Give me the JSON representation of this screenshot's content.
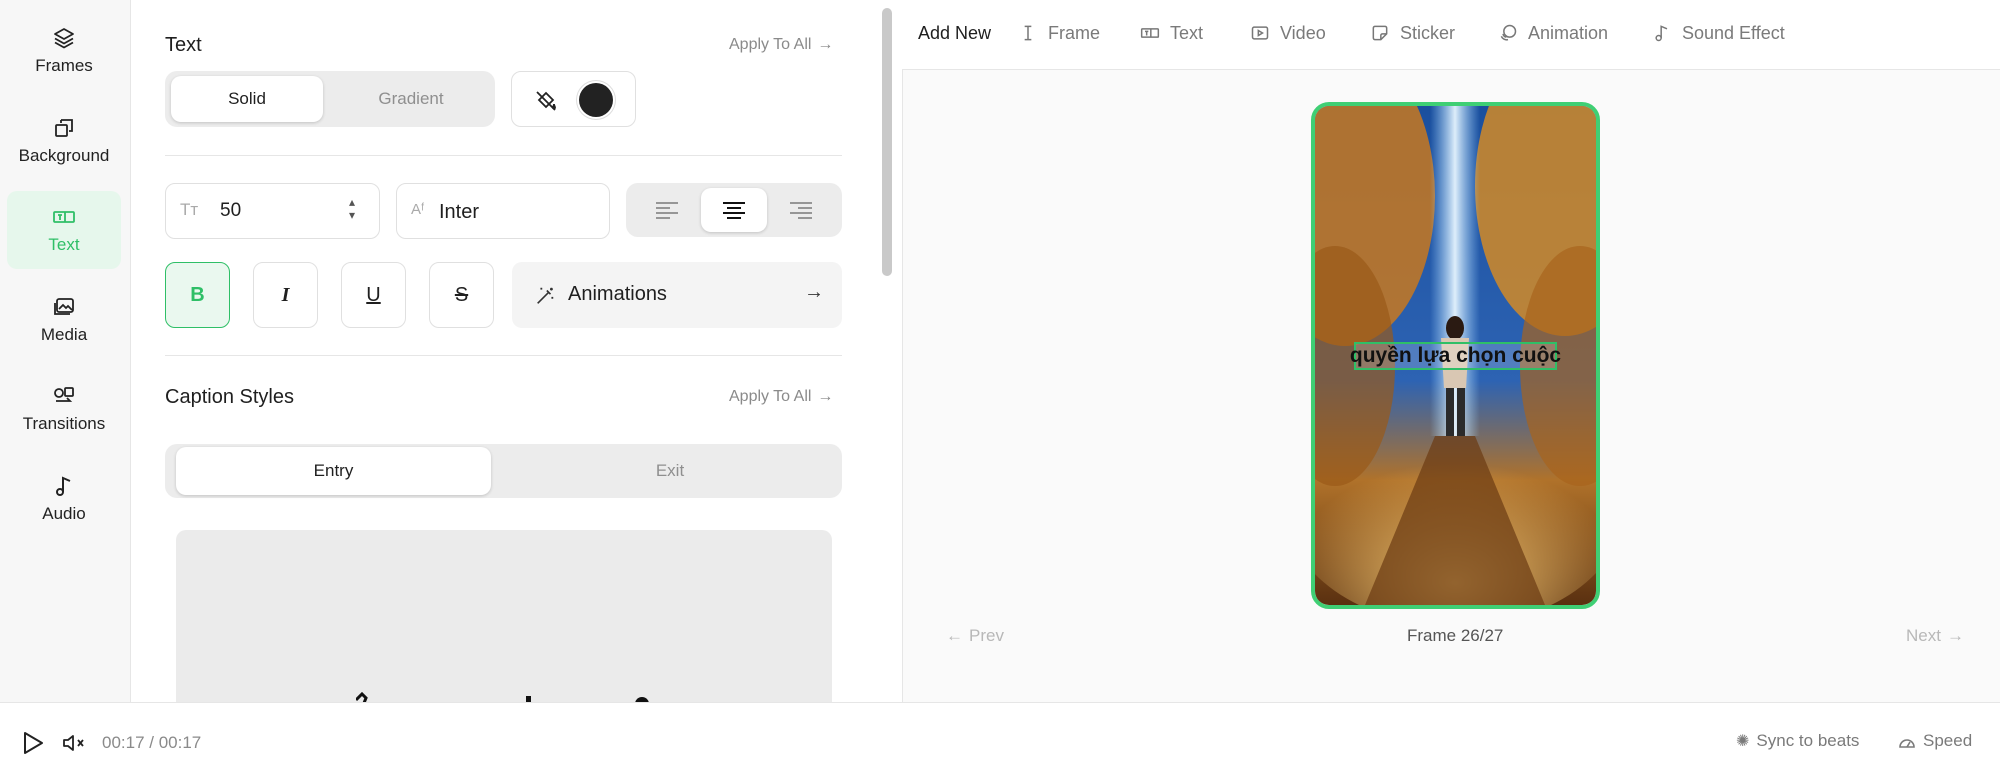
{
  "sidebar": {
    "items": [
      {
        "label": "Frames",
        "icon": "layers-icon"
      },
      {
        "label": "Background",
        "icon": "background-icon"
      },
      {
        "label": "Text",
        "icon": "text-icon",
        "active": true
      },
      {
        "label": "Media",
        "icon": "media-icon"
      },
      {
        "label": "Transitions",
        "icon": "transitions-icon"
      },
      {
        "label": "Audio",
        "icon": "audio-icon"
      }
    ]
  },
  "text_section": {
    "title": "Text",
    "apply_all": "Apply To All",
    "fill_tabs": [
      "Solid",
      "Gradient"
    ],
    "fill_selected": "Solid",
    "color": "#222222",
    "font_size": "50",
    "font_family": "Inter",
    "alignment_selected": "center",
    "format_buttons": {
      "bold": "B",
      "italic": "I",
      "underline": "U",
      "strikethrough": "S"
    },
    "bold_active": true,
    "animations_label": "Animations"
  },
  "caption_section": {
    "title": "Caption Styles",
    "apply_all": "Apply To All",
    "tabs": [
      "Entry",
      "Exit"
    ],
    "tab_selected": "Entry"
  },
  "topbar": {
    "add_new": "Add New",
    "items": [
      {
        "label": "Frame",
        "icon": "text-cursor-icon"
      },
      {
        "label": "Text",
        "icon": "text-box-icon"
      },
      {
        "label": "Video",
        "icon": "video-icon"
      },
      {
        "label": "Sticker",
        "icon": "sticker-icon"
      },
      {
        "label": "Animation",
        "icon": "animation-icon"
      },
      {
        "label": "Sound Effect",
        "icon": "music-note-icon"
      }
    ]
  },
  "preview": {
    "caption": "quyền lựa chọn cuộc",
    "frame_label": "Frame 26/27",
    "prev": "Prev",
    "next": "Next",
    "border_color": "#3fcf74"
  },
  "playback": {
    "time": "00:17 / 00:17",
    "sync": "Sync to beats",
    "speed": "Speed"
  },
  "colors": {
    "accent": "#2fbf67"
  }
}
